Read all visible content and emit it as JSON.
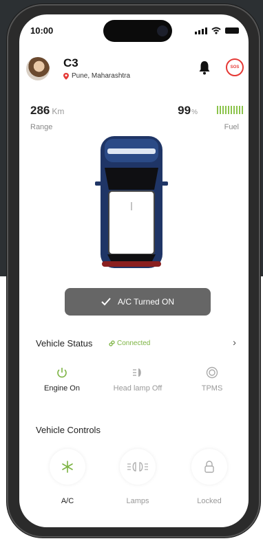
{
  "status_bar": {
    "time": "10:00"
  },
  "header": {
    "vehicle_name": "C3",
    "location": "Pune, Maharashtra"
  },
  "stats": {
    "range_value": "286",
    "range_unit": "Km",
    "range_label": "Range",
    "fuel_value": "99",
    "fuel_unit": "%",
    "fuel_label": "Fuel",
    "fuel_level": 0.99
  },
  "toast": {
    "text": "A/C Turned ON"
  },
  "vehicle_status": {
    "title": "Vehicle Status",
    "connection": "Connected",
    "items": [
      {
        "label": "Engine On",
        "icon": "power-icon",
        "active": true
      },
      {
        "label": "Head lamp Off",
        "icon": "headlamp-icon",
        "active": false
      },
      {
        "label": "TPMS",
        "icon": "tire-icon",
        "active": false
      }
    ]
  },
  "vehicle_controls": {
    "title": "Vehicle Controls",
    "items": [
      {
        "label": "A/C",
        "icon": "fan-icon",
        "active": true
      },
      {
        "label": "Lamps",
        "icon": "lamps-icon",
        "active": false
      },
      {
        "label": "Locked",
        "icon": "lock-icon",
        "active": false
      }
    ]
  },
  "colors": {
    "accent": "#7cb342",
    "sos": "#e53935",
    "car_body": "#1f3566",
    "toast_bg": "#666666"
  }
}
